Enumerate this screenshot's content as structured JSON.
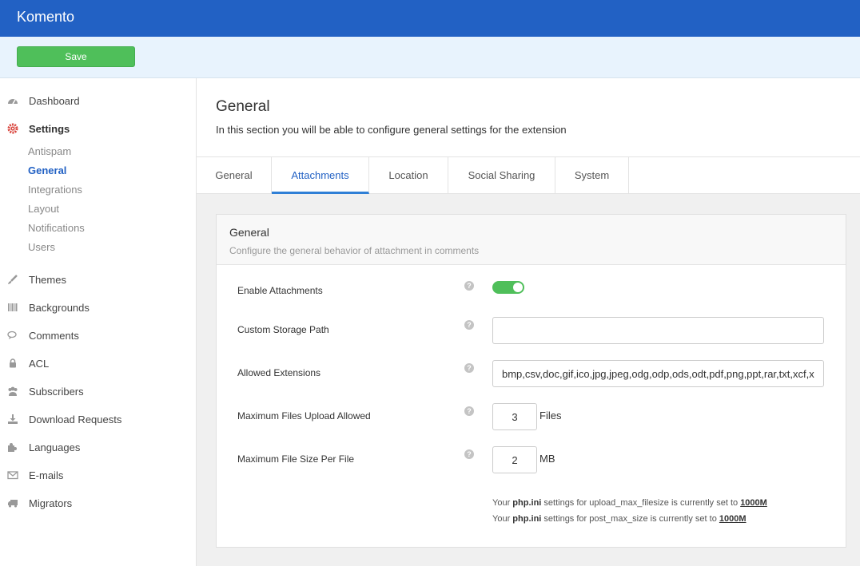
{
  "app": {
    "title": "Komento"
  },
  "toolbar": {
    "save_label": "Save"
  },
  "sidebar": {
    "items": [
      {
        "label": "Dashboard",
        "icon": "dashboard-icon"
      },
      {
        "label": "Settings",
        "icon": "gear-icon"
      },
      {
        "label": "Themes",
        "icon": "brush-icon"
      },
      {
        "label": "Backgrounds",
        "icon": "barcode-icon"
      },
      {
        "label": "Comments",
        "icon": "comments-icon"
      },
      {
        "label": "ACL",
        "icon": "lock-icon"
      },
      {
        "label": "Subscribers",
        "icon": "users-icon"
      },
      {
        "label": "Download Requests",
        "icon": "download-icon"
      },
      {
        "label": "Languages",
        "icon": "puzzle-icon"
      },
      {
        "label": "E-mails",
        "icon": "envelope-icon"
      },
      {
        "label": "Migrators",
        "icon": "truck-icon"
      }
    ],
    "settings_sub": [
      "Antispam",
      "General",
      "Integrations",
      "Layout",
      "Notifications",
      "Users"
    ]
  },
  "page": {
    "title": "General",
    "description": "In this section you will be able to configure general settings for the extension"
  },
  "tabs": [
    "General",
    "Attachments",
    "Location",
    "Social Sharing",
    "System"
  ],
  "panel": {
    "title": "General",
    "description": "Configure the general behavior of attachment in comments",
    "fields": {
      "enable_attachments": {
        "label": "Enable Attachments",
        "value": true
      },
      "custom_storage_path": {
        "label": "Custom Storage Path",
        "value": ""
      },
      "allowed_extensions": {
        "label": "Allowed Extensions",
        "value": "bmp,csv,doc,gif,ico,jpg,jpeg,odg,odp,ods,odt,pdf,png,ppt,rar,txt,xcf,xls,zip"
      },
      "max_files": {
        "label": "Maximum Files Upload Allowed",
        "value": "3",
        "unit": "Files"
      },
      "max_size": {
        "label": "Maximum File Size Per File",
        "value": "2",
        "unit": "MB"
      }
    },
    "notes": [
      {
        "pre": "Your ",
        "bold": "php.ini",
        "mid": " settings for upload_max_filesize is currently set to ",
        "value": "1000M"
      },
      {
        "pre": "Your ",
        "bold": "php.ini",
        "mid": " settings for post_max_size is currently set to ",
        "value": "1000M"
      }
    ]
  }
}
